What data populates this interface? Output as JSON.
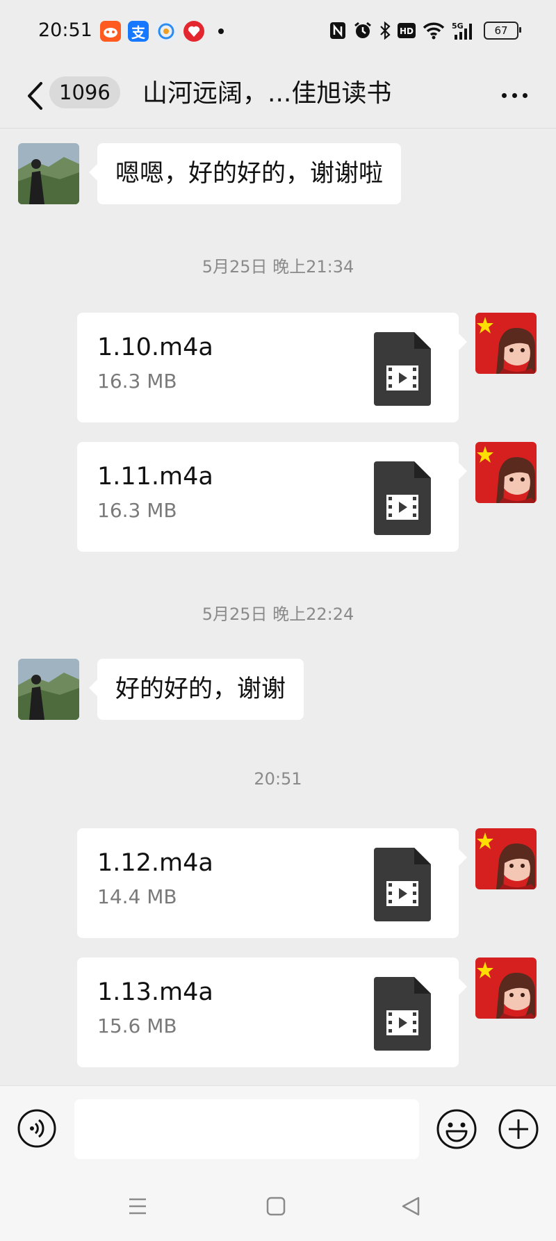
{
  "status_bar": {
    "time": "20:51",
    "apps": [
      {
        "icon": "taobao-icon",
        "glyph": "",
        "color": "#ff5a1f"
      },
      {
        "icon": "alipay-icon",
        "glyph": "支",
        "color": "#1677ff"
      },
      {
        "icon": "browser-icon",
        "glyph": "",
        "color": "#e9eef5"
      },
      {
        "icon": "jd-618-icon",
        "glyph": "",
        "color": "#e4262f"
      }
    ],
    "battery_level": "67",
    "network": "5G"
  },
  "header": {
    "back_icon": "chevron-left-icon",
    "unread_count": "1096",
    "title": "山河远阔，...佳旭读书",
    "more_icon": "more-dots-icon"
  },
  "messages": [
    {
      "type": "text",
      "side": "left",
      "text": "嗯嗯，好的好的，谢谢啦"
    },
    {
      "type": "timestamp",
      "text": "5月25日 晚上21:34"
    },
    {
      "type": "file",
      "side": "right",
      "name": "1.10.m4a",
      "size": "16.3 MB",
      "icon": "video-file-icon"
    },
    {
      "type": "file",
      "side": "right",
      "name": "1.11.m4a",
      "size": "16.3 MB",
      "icon": "video-file-icon"
    },
    {
      "type": "timestamp",
      "text": "5月25日 晚上22:24"
    },
    {
      "type": "text",
      "side": "left",
      "text": "好的好的，谢谢"
    },
    {
      "type": "timestamp",
      "text": "20:51"
    },
    {
      "type": "file",
      "side": "right",
      "name": "1.12.m4a",
      "size": "14.4 MB",
      "icon": "video-file-icon"
    },
    {
      "type": "file",
      "side": "right",
      "name": "1.13.m4a",
      "size": "15.6 MB",
      "icon": "video-file-icon"
    }
  ],
  "input_bar": {
    "voice_icon": "voice-icon",
    "input_value": "",
    "emoji_icon": "emoji-icon",
    "plus_icon": "plus-icon"
  },
  "nav_bar": {
    "menu_icon": "menu-icon",
    "home_icon": "home-icon",
    "back_icon": "triangle-back-icon"
  },
  "colors": {
    "background": "#ededed",
    "bubble": "#ffffff",
    "file_icon": "#3a3a3a",
    "timestamp": "#8a8a8a"
  }
}
